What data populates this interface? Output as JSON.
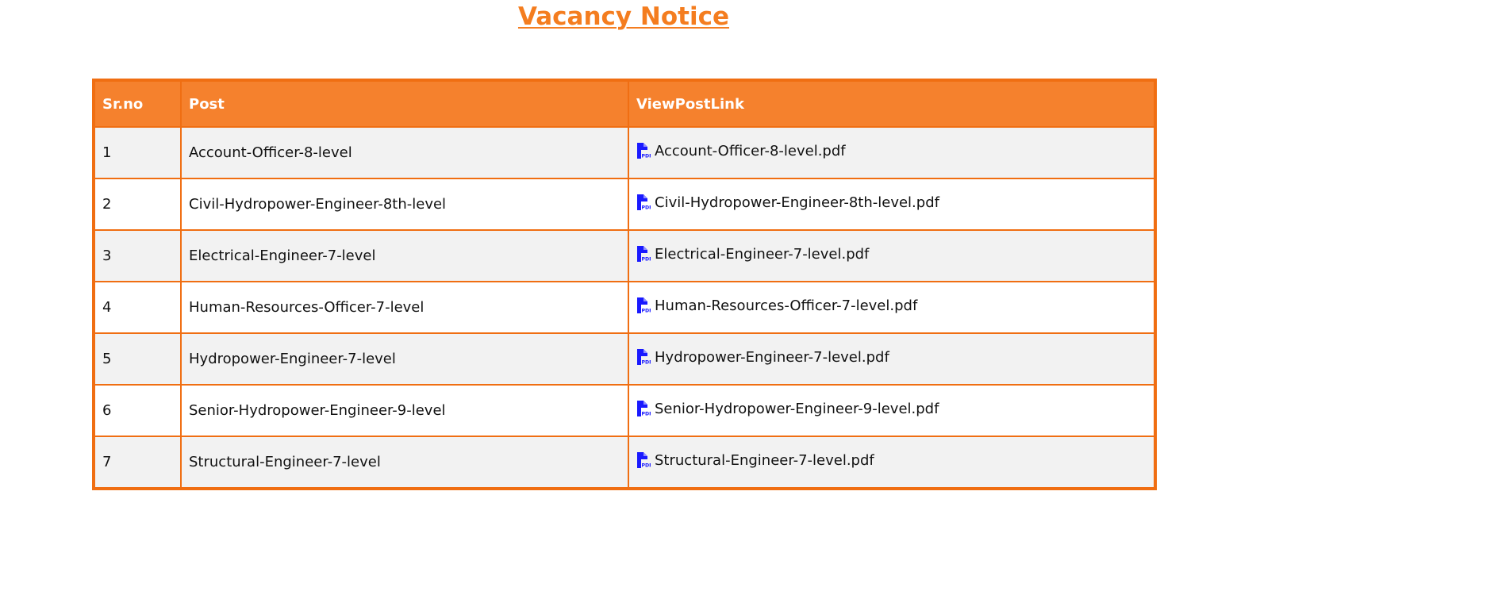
{
  "page": {
    "title": "Vacancy Notice"
  },
  "table": {
    "headers": [
      "Sr.no",
      "Post",
      "ViewPostLink"
    ],
    "rows": [
      {
        "sr": "1",
        "post": "Account-Officer-8-level",
        "link": "Account-Officer-8-level.pdf"
      },
      {
        "sr": "2",
        "post": "Civil-Hydropower-Engineer-8th-level",
        "link": "Civil-Hydropower-Engineer-8th-level.pdf"
      },
      {
        "sr": "3",
        "post": "Electrical-Engineer-7-level",
        "link": "Electrical-Engineer-7-level.pdf"
      },
      {
        "sr": "4",
        "post": "Human-Resources-Officer-7-level",
        "link": "Human-Resources-Officer-7-level.pdf"
      },
      {
        "sr": "5",
        "post": "Hydropower-Engineer-7-level",
        "link": "Hydropower-Engineer-7-level.pdf"
      },
      {
        "sr": "6",
        "post": "Senior-Hydropower-Engineer-9-level",
        "link": "Senior-Hydropower-Engineer-9-level.pdf"
      },
      {
        "sr": "7",
        "post": "Structural-Engineer-7-level",
        "link": "Structural-Engineer-7-level.pdf"
      }
    ]
  },
  "icons": {
    "link_icon": "pdf-file-icon"
  },
  "colors": {
    "accent": "#f47d1f",
    "border": "#f06e12",
    "header_bg": "#f5812d",
    "icon": "#1a1aff"
  }
}
